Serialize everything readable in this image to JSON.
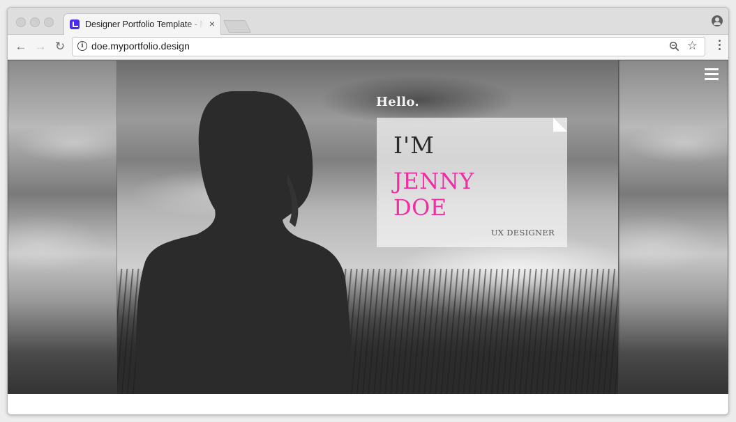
{
  "browser": {
    "tab": {
      "title": "Designer Portfolio Template - My",
      "close": "×"
    },
    "toolbar": {
      "back_icon": "←",
      "forward_icon": "→",
      "reload_icon": "↻",
      "info_icon": "i",
      "url": "doe.myportfolio.design",
      "star_icon": "☆"
    }
  },
  "hero": {
    "greeting": "Hello.",
    "card": {
      "intro": "I'M",
      "first_name": "JENNY",
      "last_name": "DOE",
      "role": "UX DESIGNER"
    },
    "accent_color": "#ee2fa3"
  }
}
